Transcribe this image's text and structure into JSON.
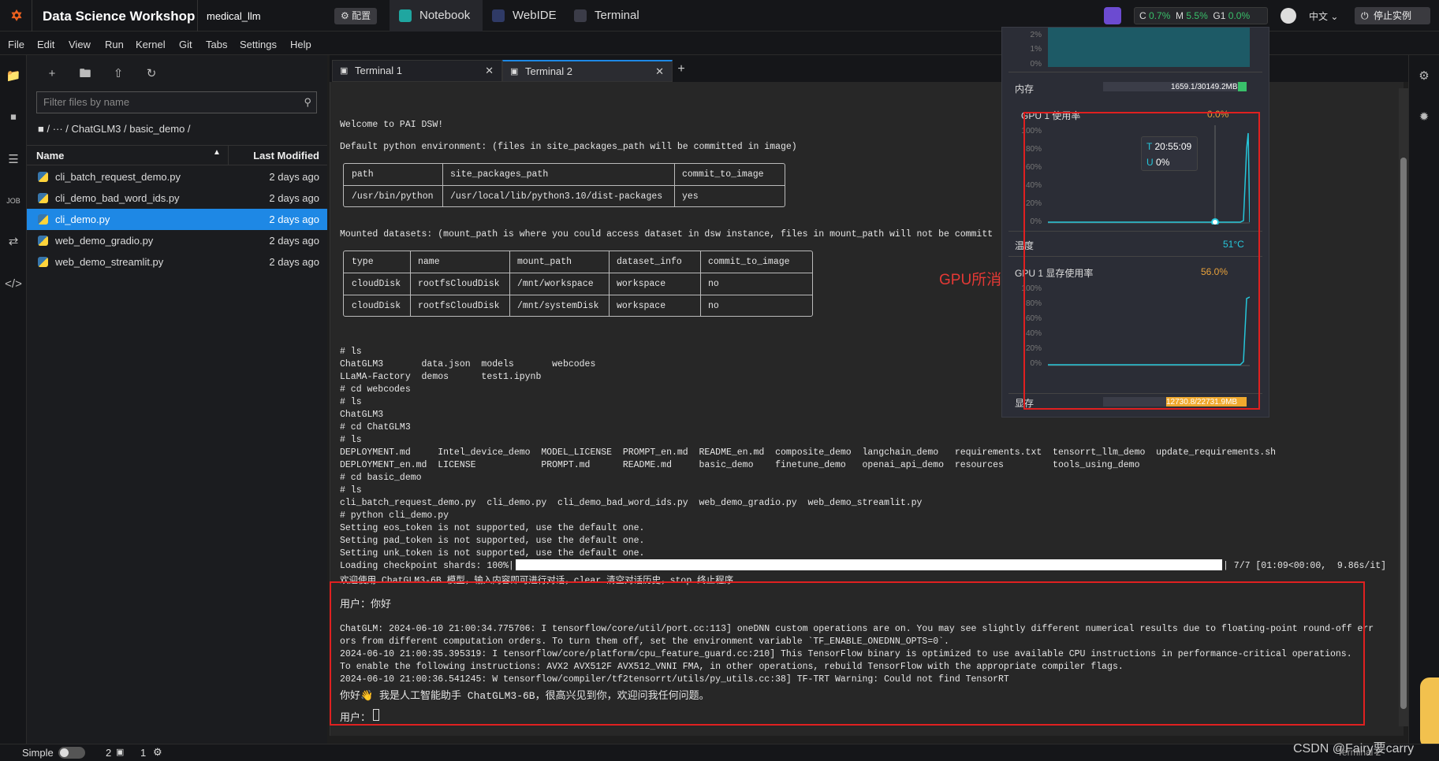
{
  "topbar": {
    "app_title": "Data Science Workshop",
    "workspace": "medical_llm",
    "config_label": "配置",
    "tabs": [
      "Notebook",
      "WebIDE",
      "Terminal"
    ],
    "resources": {
      "c_label": "C",
      "c_val": "0.7%",
      "m_label": "M",
      "m_val": "5.5%",
      "g_label": "G1",
      "g_val": "0.0%"
    },
    "language": "中文",
    "stop_label": "停止实例"
  },
  "menubar": [
    "File",
    "Edit",
    "View",
    "Run",
    "Kernel",
    "Git",
    "Tabs",
    "Settings",
    "Help"
  ],
  "filebrowser": {
    "filter_placeholder": "Filter files by name",
    "breadcrumb": "/  ···  / ChatGLM3 / basic_demo /",
    "col_name": "Name",
    "col_modified": "Last Modified",
    "files": [
      {
        "name": "cli_batch_request_demo.py",
        "modified": "2 days ago"
      },
      {
        "name": "cli_demo_bad_word_ids.py",
        "modified": "2 days ago"
      },
      {
        "name": "cli_demo.py",
        "modified": "2 days ago"
      },
      {
        "name": "web_demo_gradio.py",
        "modified": "2 days ago"
      },
      {
        "name": "web_demo_streamlit.py",
        "modified": "2 days ago"
      }
    ]
  },
  "main_tabs": [
    "Terminal 1",
    "Terminal 2"
  ],
  "terminal": {
    "welcome": "Welcome to PAI DSW!",
    "default_env": "Default python environment: (files in site_packages_path will be committed in image)",
    "env_table": {
      "headers": [
        "path",
        "site_packages_path",
        "commit_to_image"
      ],
      "row": [
        "/usr/bin/python",
        "/usr/local/lib/python3.10/dist-packages",
        "yes"
      ]
    },
    "mounted": "Mounted datasets: (mount_path is where you could access dataset in dsw instance, files in mount_path will not be committ",
    "ds_table": {
      "headers": [
        "type",
        "name",
        "mount_path",
        "dataset_info",
        "commit_to_image"
      ],
      "rows": [
        [
          "cloudDisk",
          "rootfsCloudDisk",
          "/mnt/workspace",
          "workspace",
          "no"
        ],
        [
          "cloudDisk",
          "rootfsCloudDisk",
          "/mnt/systemDisk",
          "workspace",
          "no"
        ]
      ]
    },
    "lines": [
      "# ls",
      "ChatGLM3       data.json  models       webcodes",
      "LLaMA-Factory  demos      test1.ipynb",
      "# cd webcodes",
      "# ls",
      "ChatGLM3",
      "# cd ChatGLM3",
      "# ls",
      "DEPLOYMENT.md     Intel_device_demo  MODEL_LICENSE  PROMPT_en.md  README_en.md  composite_demo  langchain_demo   requirements.txt  tensorrt_llm_demo  update_requirements.sh",
      "DEPLOYMENT_en.md  LICENSE            PROMPT.md      README.md     basic_demo    finetune_demo   openai_api_demo  resources         tools_using_demo",
      "# cd basic_demo",
      "# ls",
      "cli_batch_request_demo.py  cli_demo.py  cli_demo_bad_word_ids.py  web_demo_gradio.py  web_demo_streamlit.py",
      "# python cli_demo.py",
      "Setting eos_token is not supported, use the default one.",
      "Setting pad_token is not supported, use the default one.",
      "Setting unk_token is not supported, use the default one."
    ],
    "loading": "Loading checkpoint shards: 100%|",
    "loading_tail": "| 7/7 [01:09<00:00,  9.86s/it]",
    "welcome_cn": "欢迎使用 ChatGLM3-6B 模型，输入内容即可进行对话，clear 清空对话历史，stop 终止程序",
    "user1": "用户：你好",
    "log_lines": [
      "ChatGLM: 2024-06-10 21:00:34.775706: I tensorflow/core/util/port.cc:113] oneDNN custom operations are on. You may see slightly different numerical results due to floating-point round-off err",
      "ors from different computation orders. To turn them off, set the environment variable `TF_ENABLE_ONEDNN_OPTS=0`.",
      "2024-06-10 21:00:35.395319: I tensorflow/core/platform/cpu_feature_guard.cc:210] This TensorFlow binary is optimized to use available CPU instructions in performance-critical operations.",
      "To enable the following instructions: AVX2 AVX512F AVX512_VNNI FMA, in other operations, rebuild TensorFlow with the appropriate compiler flags.",
      "2024-06-10 21:00:36.541245: W tensorflow/compiler/tf2tensorrt/utils/py_utils.cc:38] TF-TRT Warning: Could not find TensorRT"
    ],
    "reply": "你好👋 我是人工智能助手 ChatGLM3-6B，很高兴见到你，欢迎问我任何问题。",
    "user2": "用户："
  },
  "gpu_panel": {
    "top_ticks": [
      "2%",
      "1%",
      "0%"
    ],
    "mem_label": "内存",
    "mem_value": "1659.1/30149.2MB",
    "mem_fraction": 0.055,
    "gpu_util_label": "GPU 1 使用率",
    "gpu_util_value": "0.0%",
    "util_ticks": [
      "100%",
      "80%",
      "60%",
      "40%",
      "20%",
      "0%"
    ],
    "tooltip_time": "20:55:09",
    "tooltip_t": "T",
    "tooltip_u": "U",
    "tooltip_u_val": "0%",
    "temp_label": "温度",
    "temp_value": "51°C",
    "vram_label": "GPU 1 显存使用率",
    "vram_value": "56.0%",
    "vram_ticks": [
      "100%",
      "80%",
      "60%",
      "40%",
      "20%",
      "0%"
    ],
    "vmem_label": "显存",
    "vmem_value": "12730.8/22731.9MB",
    "vmem_fraction": 0.56
  },
  "annotation": "GPU所消耗资源",
  "statusbar": {
    "mode": "Simple",
    "count1": "2",
    "count2": "1",
    "right": "Terminal 2"
  },
  "watermark": "CSDN @Fairy要carry",
  "colors": {
    "accent": "#1e88e5",
    "red": "#e02020",
    "chart_line": "#26c6da",
    "green": "#39c06a",
    "orange": "#e9a23b"
  }
}
